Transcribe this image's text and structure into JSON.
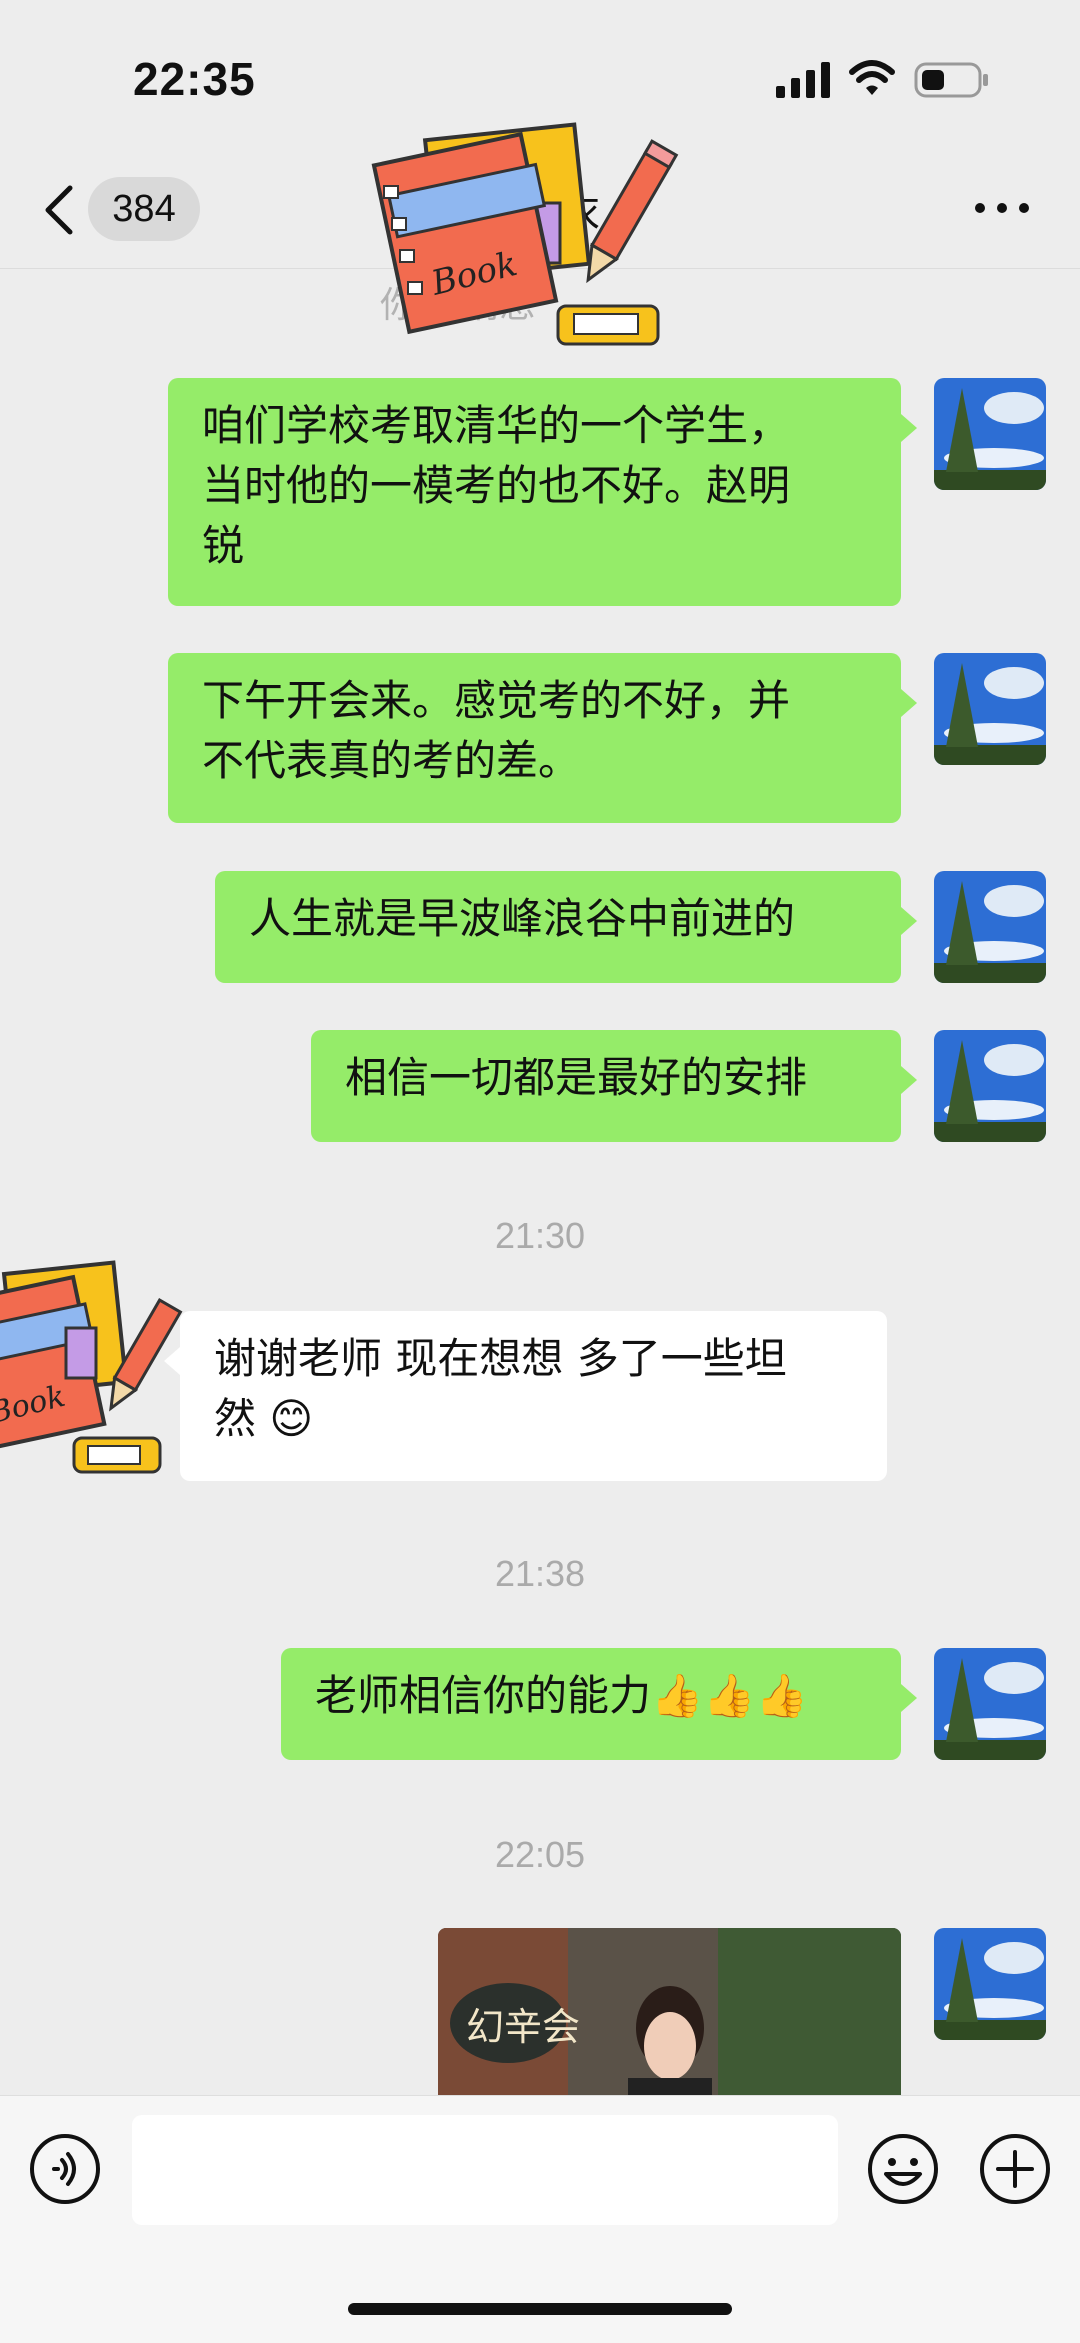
{
  "status_bar": {
    "time": "22:35",
    "signal_icon": "signal-bars-icon",
    "wifi_icon": "wifi-icon",
    "battery_icon": "battery-icon",
    "battery_level": 0.3
  },
  "nav": {
    "back_icon": "chevron-left-icon",
    "unread_count": "384",
    "title": "衣",
    "more_icon": "more-dots-icon",
    "sub_notice": "你            条消息"
  },
  "messages": [
    {
      "side": "right",
      "text": "咱们学校考取清华的一个学生，当时他的一模考的也不好。赵明锐"
    },
    {
      "side": "right",
      "text": "下午开会来。感觉考的不好，并不代表真的考的差。"
    },
    {
      "side": "right",
      "text": "人生就是早波峰浪谷中前进的"
    },
    {
      "side": "right",
      "text": "相信一切都是最好的安排"
    },
    {
      "timestamp": "21:30"
    },
    {
      "side": "left",
      "text": "谢谢老师 现在想想 多了一些坦然 😊"
    },
    {
      "timestamp": "21:38"
    },
    {
      "side": "right",
      "text": "老师相信你的能力👍👍👍"
    },
    {
      "timestamp": "22:05"
    },
    {
      "side": "right",
      "type": "video",
      "overlay_text": "幻辛会"
    }
  ],
  "msg": {
    "m1": "咱们学校考取清华的一个学生，",
    "m1b": "当时他的一模考的也不好。赵明",
    "m1c": "锐",
    "m2": "下午开会来。感觉考的不好，并",
    "m2b": "不代表真的考的差。",
    "m3": "人生就是早波峰浪谷中前进的",
    "m4": "相信一切都是最好的安排",
    "ts1": "21:30",
    "m5": "谢谢老师 现在想想 多了一些坦",
    "m5b": "然 😊",
    "ts2": "21:38",
    "m6": "老师相信你的能力👍👍👍",
    "ts3": "22:05",
    "video_overlay": "幻辛会"
  },
  "input_bar": {
    "voice_icon": "voice-icon",
    "input_value": "",
    "emoji_icon": "emoji-icon",
    "plus_icon": "plus-circle-icon"
  },
  "colors": {
    "background": "#ededed",
    "self_bubble": "#95ec69",
    "other_bubble": "#ffffff",
    "timestamp": "#aaaaaa"
  }
}
